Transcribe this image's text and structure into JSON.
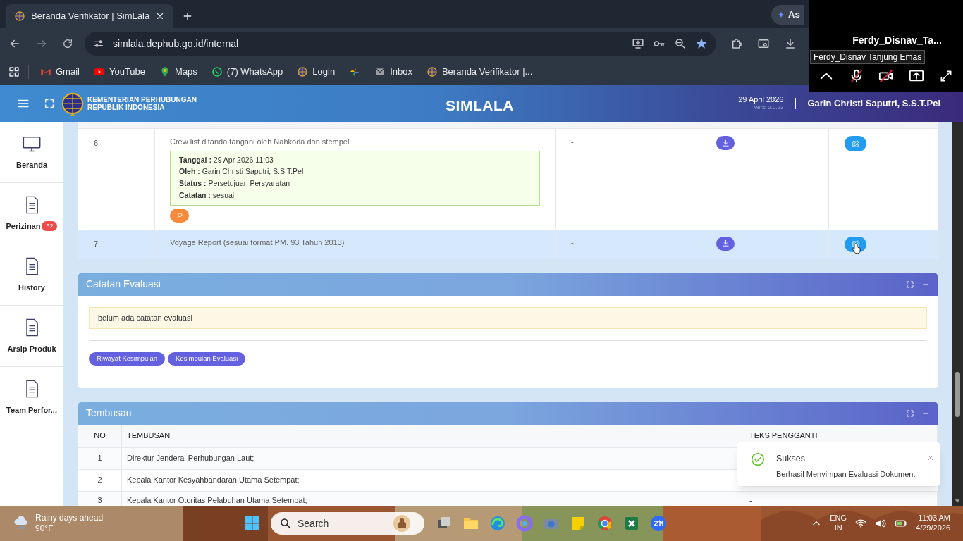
{
  "browser": {
    "tab_title": "Beranda Verifikator | SimLala",
    "side_tab": "As",
    "url": "simlala.dephub.go.id/internal",
    "bookmarks": [
      {
        "label": "Gmail",
        "kind": "gmail"
      },
      {
        "label": "YouTube",
        "kind": "youtube"
      },
      {
        "label": "Maps",
        "kind": "maps"
      },
      {
        "label": "(7) WhatsApp",
        "kind": "whatsapp"
      },
      {
        "label": "Login",
        "kind": "globe"
      },
      {
        "kind": "photos"
      },
      {
        "label": "Inbox",
        "kind": "mail"
      },
      {
        "label": "Beranda Verifikator |...",
        "kind": "globe"
      }
    ]
  },
  "call_overlay": {
    "name": "Ferdy_Disnav_Ta...",
    "tooltip": "Ferdy_Disnav Tanjung Emas"
  },
  "header": {
    "org_line_1": "KEMENTERIAN PERHUBUNGAN",
    "org_line_2": "REPUBLIK INDONESIA",
    "title": "SIMLALA",
    "date": "29 April 2026",
    "version": "versi 2.0.23",
    "user": "Garin Christi Saputri, S.S.T.Pel"
  },
  "sidebar": {
    "items": [
      {
        "label": "Beranda",
        "kind": "monitor"
      },
      {
        "label": "Perizinan",
        "kind": "doc",
        "badge": "62"
      },
      {
        "label": "History",
        "kind": "doc"
      },
      {
        "label": "Arsip Produk",
        "kind": "doc"
      },
      {
        "label": "Team Perfor...",
        "kind": "doc"
      }
    ]
  },
  "documents": {
    "rows": [
      {
        "no": "6",
        "title": "Crew list ditanda tangani oleh Nahkoda dan stempel",
        "review": [
          {
            "label": "Tanggal :",
            "value": "29 Apr 2026 11:03"
          },
          {
            "label": "Oleh :",
            "value": "Garin Christi Saputri, S.S.T.Pel"
          },
          {
            "label": "Status :",
            "value": "Persetujuan Persyaratan"
          },
          {
            "label": "Catatan :",
            "value": "sesuai"
          }
        ],
        "note": "-",
        "highlighted": false
      },
      {
        "no": "7",
        "title": "Voyage Report (sesuai format PM. 93 Tahun 2013)",
        "note": "-",
        "highlighted": true
      }
    ]
  },
  "catatan_evaluasi": {
    "title": "Catatan Evaluasi",
    "message": "belum ada catatan evaluasi",
    "buttons": [
      "Riwayat Kesimpulan",
      "Kesimpulan Evaluasi"
    ]
  },
  "tembusan": {
    "title": "Tembusan",
    "columns": [
      "NO",
      "TEMBUSAN",
      "TEKS PENGGANTI"
    ],
    "rows": [
      {
        "no": "1",
        "text": "Direktur Jenderal Perhubungan Laut;"
      },
      {
        "no": "2",
        "text": "Kepala Kantor Kesyahbandaran Utama Setempat;"
      },
      {
        "no": "3",
        "text": "Kepala Kantor Otoritas Pelabuhan Utama Setempat;",
        "replacement": "-"
      }
    ]
  },
  "toast": {
    "title": "Sukses",
    "message": "Berhasil Menyimpan Evaluasi Dokumen."
  },
  "taskbar": {
    "weather": "Rainy days ahead",
    "temperature": "90°F",
    "search_placeholder": "Search",
    "language": "ENG",
    "region": "IN",
    "time": "11:03 AM",
    "date": "4/29/2026"
  }
}
